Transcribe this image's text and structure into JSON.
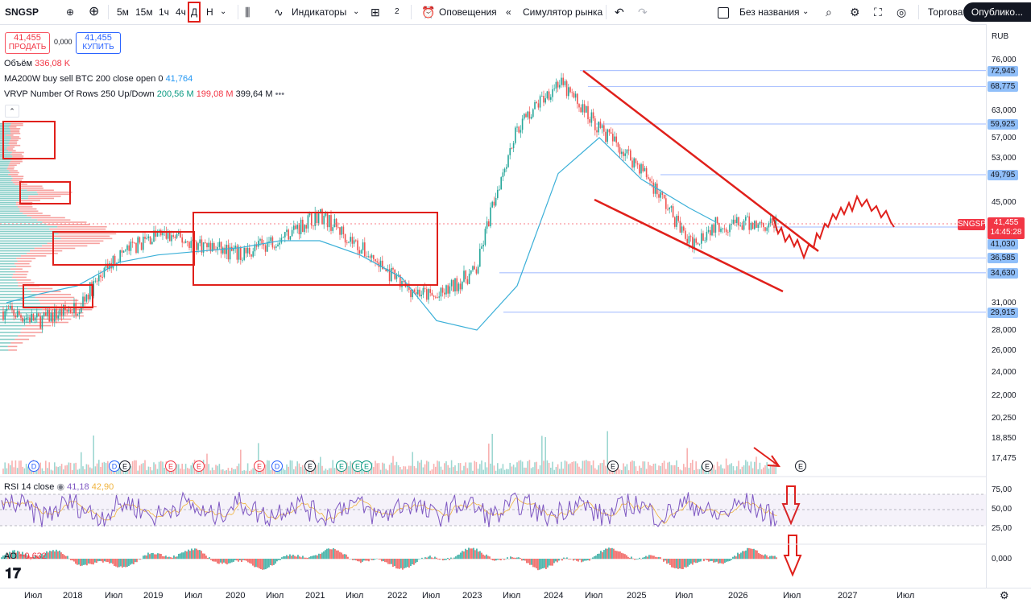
{
  "toolbar": {
    "symbol": "SNGSP",
    "timeframes": [
      "5м",
      "15м",
      "1ч",
      "4ч",
      "Д",
      "Н"
    ],
    "indicators_label": "Индикаторы",
    "layout_count": "2",
    "alerts_label": "Оповещения",
    "replay_label": "Симулятор рынка",
    "layout_name": "Без названия",
    "trade_label": "Торговать",
    "publish_label": "Опублико..."
  },
  "trade": {
    "sell_price": "41,455",
    "sell_label": "ПРОДАТЬ",
    "spread": "0,000",
    "buy_price": "41,455",
    "buy_label": "КУПИТЬ"
  },
  "legend": {
    "volume_label": "Объём",
    "volume_value": "336,08 K",
    "ma_label": "MA200W buy sell BTC 200 close open 0",
    "ma_value": "41,764",
    "vrvp_label": "VRVP Number Of Rows 250 Up/Down",
    "vrvp_up": "200,56 M",
    "vrvp_down": "199,08 M",
    "vrvp_total": "399,64 M"
  },
  "rsi_legend": {
    "label": "RSI 14 close",
    "v1": "41,18",
    "v2": "42,90"
  },
  "ao_legend": {
    "label": "AO",
    "value": "−0,632"
  },
  "price_axis": {
    "currency": "RUB",
    "ticks": [
      "76,000",
      "63,000",
      "57,000",
      "53,000",
      "45,000",
      "31,000",
      "28,000",
      "26,000",
      "24,000",
      "22,000",
      "20,250",
      "18,850",
      "17,475"
    ],
    "badges": [
      "72,945",
      "68,775",
      "59,925",
      "49,795",
      "41,030",
      "36,585",
      "34,630",
      "29,915"
    ],
    "last_symbol": "SNGSP",
    "last_price": "41,455",
    "last_time": "14:45:28",
    "rsi_ticks": [
      "75,00",
      "50,00",
      "25,00"
    ],
    "ao_tick": "0,000"
  },
  "time_axis": [
    "Июл",
    "2018",
    "Июл",
    "2019",
    "Июл",
    "2020",
    "Июл",
    "2021",
    "Июл",
    "2022",
    "Июл",
    "2023",
    "Июл",
    "2024",
    "Июл",
    "2025",
    "Июл",
    "2026",
    "Июл",
    "2027",
    "Июл"
  ],
  "colors": {
    "up": "#26a69a",
    "down": "#ef5350",
    "ma": "#22ab94",
    "annot": "#e0201b",
    "rsi": "#7e57c2",
    "rsi_ma": "#f0b33c"
  },
  "chart_data": {
    "type": "candlestick",
    "symbol": "SNGSP",
    "timeframe": "Д",
    "currency": "RUB",
    "x": [
      "2017-07",
      "2018-01",
      "2018-07",
      "2019-01",
      "2019-07",
      "2020-01",
      "2020-07",
      "2021-01",
      "2021-07",
      "2022-01",
      "2022-07",
      "2023-01",
      "2023-07",
      "2024-01",
      "2024-07",
      "2025-01",
      "2025-07",
      "2026-01",
      "2026-04"
    ],
    "close": [
      30,
      29,
      30.5,
      37,
      40,
      38.5,
      37,
      39.5,
      43,
      38,
      33,
      31.5,
      35,
      59,
      70,
      59,
      51,
      38.5,
      41.455
    ],
    "ma200w": [
      31,
      32,
      33,
      36,
      37,
      37.5,
      38,
      39,
      39,
      37,
      34,
      29,
      28,
      33,
      50,
      57,
      49,
      44,
      41.764
    ],
    "ylim": [
      17.475,
      76
    ],
    "price_levels": [
      72.945,
      68.775,
      59.925,
      49.795,
      41.03,
      36.585,
      34.63,
      29.915
    ],
    "last_price": 41.455,
    "rsi": {
      "length": 14,
      "value": 41.18,
      "ma": 42.9,
      "levels": [
        75,
        50,
        25
      ]
    },
    "ao": {
      "value": -0.632
    }
  }
}
